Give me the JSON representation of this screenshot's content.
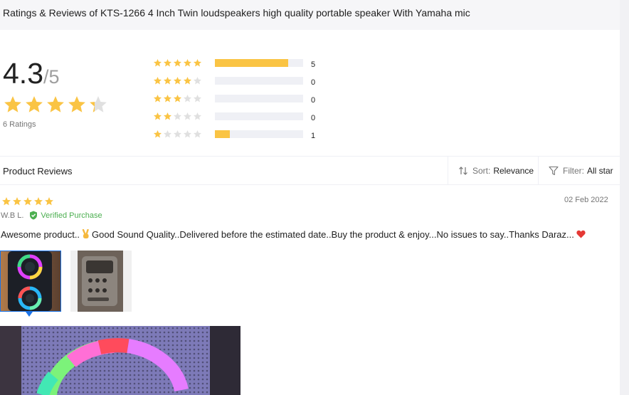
{
  "page": {
    "title": "Ratings & Reviews of KTS-1266 4 Inch Twin loudspeakers high quality portable speaker With Yamaha mic"
  },
  "summary": {
    "average": "4.3",
    "out_of": "/5",
    "average_value": 4.3,
    "ratings_label": "6 Ratings"
  },
  "distribution": [
    {
      "stars": 5,
      "count": "5",
      "fraction": 0.83
    },
    {
      "stars": 4,
      "count": "0",
      "fraction": 0
    },
    {
      "stars": 3,
      "count": "0",
      "fraction": 0
    },
    {
      "stars": 2,
      "count": "0",
      "fraction": 0
    },
    {
      "stars": 1,
      "count": "1",
      "fraction": 0.17
    }
  ],
  "reviews_header": {
    "label": "Product Reviews",
    "sort_label": "Sort:",
    "sort_value": "Relevance",
    "filter_label": "Filter:",
    "filter_value": "All star"
  },
  "review": {
    "stars": 5,
    "date": "02 Feb 2022",
    "author": "W.B L.",
    "verified_label": "Verified Purchase",
    "text_part1": "Awesome product..",
    "text_part2": "Good Sound Quality..Delivered before the estimated date..Buy the product & enjoy...No issues to say..Thanks Daraz...",
    "emoji_1": "victory-hand-icon",
    "emoji_2": "red-heart-icon"
  },
  "colors": {
    "star": "#fac444",
    "star_empty": "#e0e0e0",
    "bar_bg": "#eff0f5",
    "verified": "#4caf50",
    "selected_border": "#1a73e8"
  }
}
